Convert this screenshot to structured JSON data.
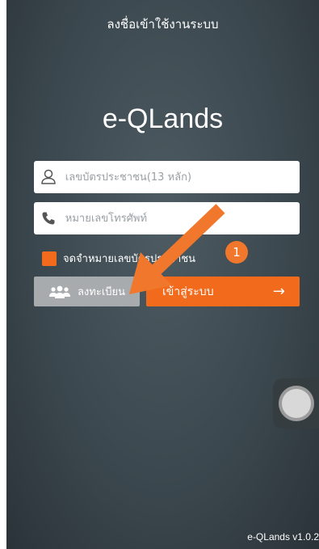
{
  "header": {
    "title": "ลงชื่อเข้าใช้งานระบบ"
  },
  "app": {
    "title": "e-QLands",
    "version": "e-QLands v1.0.2"
  },
  "form": {
    "id_card": {
      "placeholder": "เลขบัตรประชาชน(13 หลัก)",
      "icon": "user-icon"
    },
    "phone": {
      "placeholder": "หมายเลขโทรศัพท์",
      "icon": "phone-icon"
    },
    "remember": {
      "label": "จดจำหมายเลขบัตรประชาชน",
      "checked": true
    }
  },
  "buttons": {
    "register": {
      "label": "ลงทะเบียน",
      "icon": "users-icon"
    },
    "login": {
      "label": "เข้าสู่ระบบ",
      "icon": "arrow-right-icon"
    }
  },
  "annotation": {
    "step": "1",
    "color": "#f0772b"
  },
  "colors": {
    "accent": "#f26a1b",
    "register_bg": "#a7abae",
    "background": "#3f4b52"
  }
}
